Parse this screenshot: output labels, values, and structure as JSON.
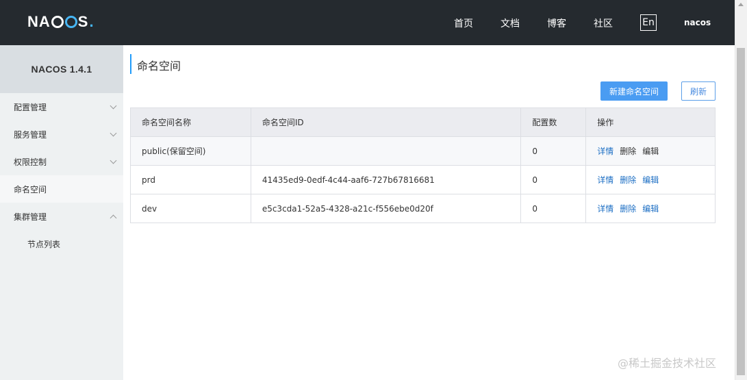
{
  "header": {
    "logo_text": "NACOS.",
    "nav": [
      "首页",
      "文档",
      "博客",
      "社区"
    ],
    "lang": "En",
    "user": "nacos"
  },
  "sidebar": {
    "version": "NACOS 1.4.1",
    "items": [
      {
        "label": "配置管理",
        "expanded": false
      },
      {
        "label": "服务管理",
        "expanded": false
      },
      {
        "label": "权限控制",
        "expanded": false
      },
      {
        "label": "命名空间",
        "active": true
      },
      {
        "label": "集群管理",
        "expanded": true
      },
      {
        "label": "节点列表",
        "sub": true
      }
    ]
  },
  "main": {
    "title": "命名空间",
    "new_button": "新建命名空间",
    "refresh_button": "刷新",
    "table": {
      "headers": [
        "命名空间名称",
        "命名空间ID",
        "配置数",
        "操作"
      ],
      "rows": [
        {
          "name": "public(保留空间)",
          "id": "",
          "count": "0",
          "actions": [
            "详情",
            "删除",
            "编辑"
          ]
        },
        {
          "name": "prd",
          "id": "41435ed9-0edf-4c44-aaf6-727b67816681",
          "count": "0",
          "actions": [
            "详情",
            "删除",
            "编辑"
          ]
        },
        {
          "name": "dev",
          "id": "e5c3cda1-52a5-4328-a21c-f556ebe0d20f",
          "count": "0",
          "actions": [
            "详情",
            "删除",
            "编辑"
          ]
        }
      ]
    }
  },
  "watermark": "@稀土掘金技术社区",
  "colors": {
    "header_bg": "#252a2f",
    "sidebar_bg": "#eef1f2",
    "primary": "#4a9cf2",
    "link": "#1d6fc4",
    "accent": "#209bfa"
  }
}
